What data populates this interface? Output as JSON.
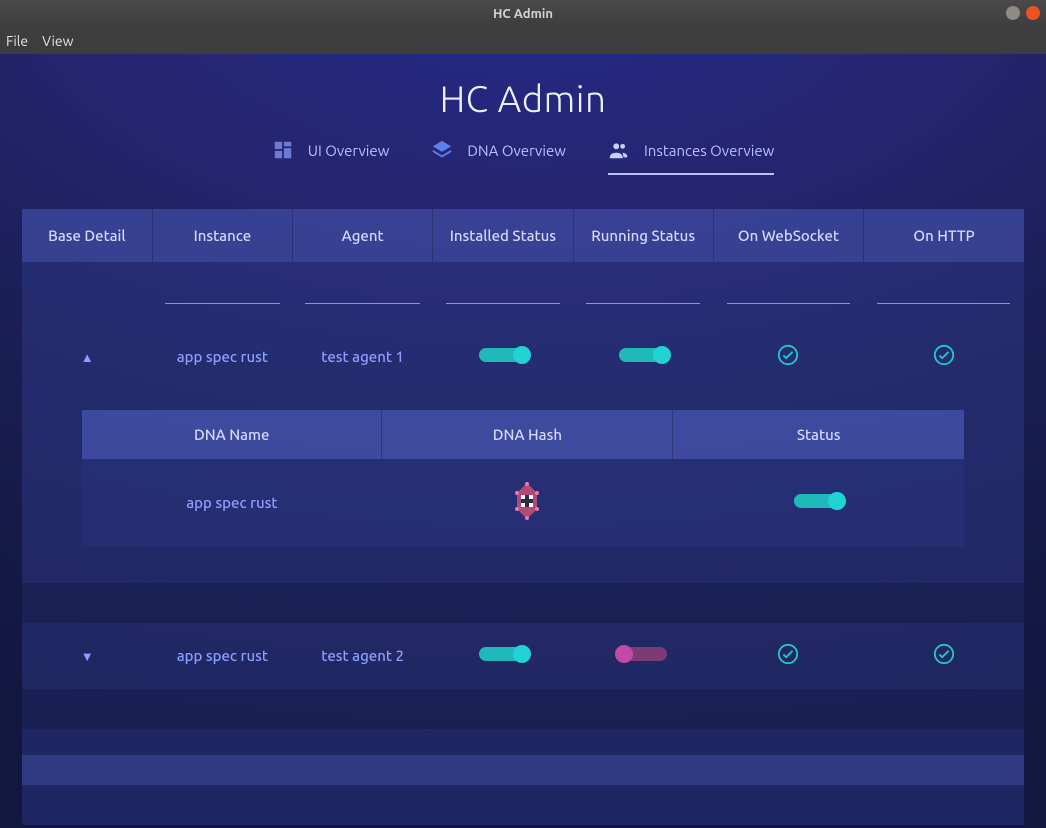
{
  "window": {
    "title": "HC Admin",
    "menu": {
      "file": "File",
      "view": "View"
    }
  },
  "header": {
    "app_title": "HC Admin",
    "tabs": [
      {
        "label": "UI Overview"
      },
      {
        "label": "DNA Overview"
      },
      {
        "label": "Instances Overview"
      }
    ]
  },
  "table": {
    "headers": {
      "base_detail": "Base Detail",
      "instance": "Instance",
      "agent": "Agent",
      "installed_status": "Installed Status",
      "running_status": "Running Status",
      "on_websocket": "On WebSocket",
      "on_http": "On HTTP"
    },
    "rows": [
      {
        "expanded": true,
        "instance": "app spec rust",
        "agent": "test agent 1",
        "installed": true,
        "running": true,
        "websocket": true,
        "http": true,
        "detail": {
          "headers": {
            "dna_name": "DNA Name",
            "dna_hash": "DNA Hash",
            "status": "Status"
          },
          "dna_name": "app spec rust",
          "status": true
        }
      },
      {
        "expanded": false,
        "instance": "app spec rust",
        "agent": "test agent 2",
        "installed": true,
        "running": false,
        "websocket": true,
        "http": true
      }
    ]
  }
}
